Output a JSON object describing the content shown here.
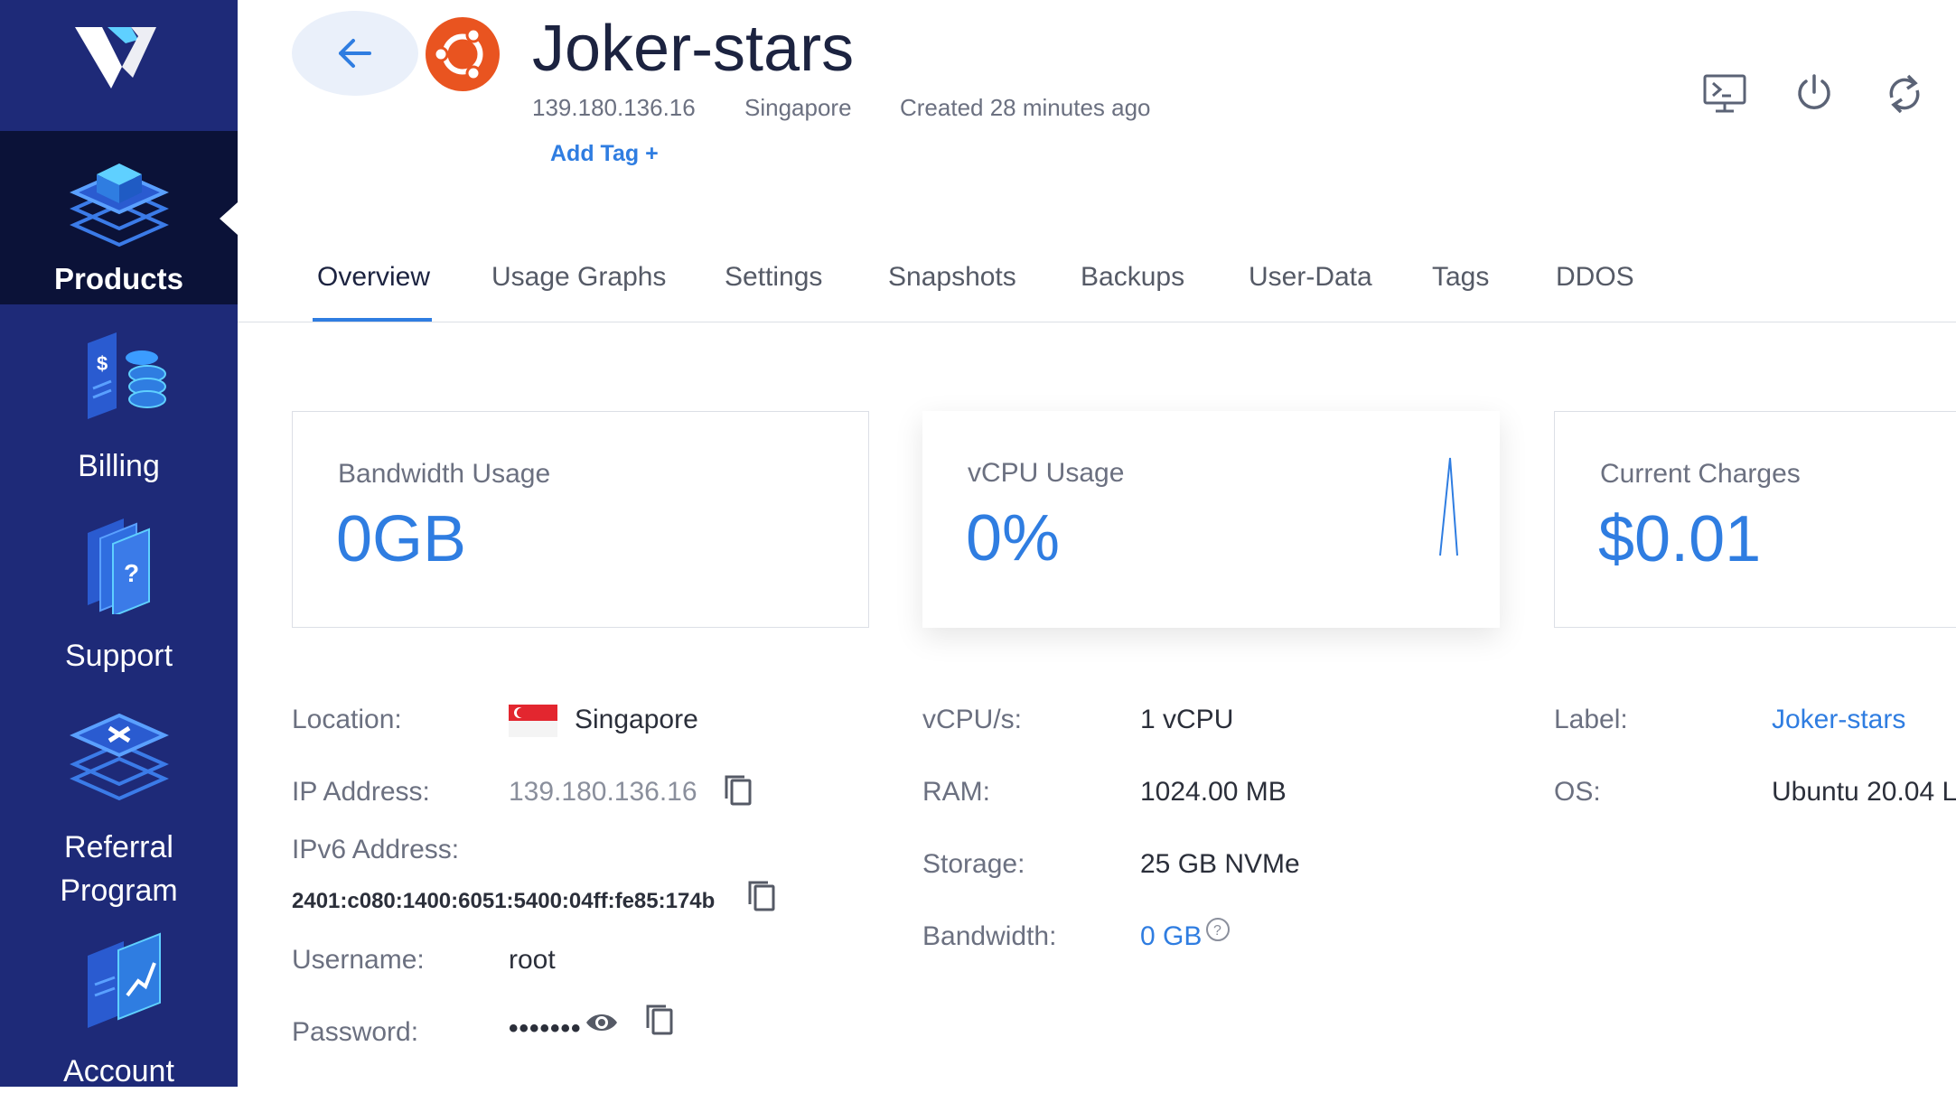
{
  "sidebar": {
    "items": [
      {
        "label": "Products",
        "icon": "products-stack-icon",
        "active": true
      },
      {
        "label": "Billing",
        "icon": "billing-coins-icon"
      },
      {
        "label": "Support",
        "icon": "support-question-icon"
      },
      {
        "label": "Referral Program",
        "label_line1": "Referral",
        "label_line2": "Program",
        "icon": "referral-icon"
      },
      {
        "label": "Account",
        "icon": "account-chart-icon"
      }
    ]
  },
  "header": {
    "title": "Joker-stars",
    "ip": "139.180.136.16",
    "location": "Singapore",
    "created": "Created 28 minutes ago",
    "add_tag": "Add Tag +",
    "os_icon": "ubuntu-logo-icon"
  },
  "tabs": [
    "Overview",
    "Usage Graphs",
    "Settings",
    "Snapshots",
    "Backups",
    "User-Data",
    "Tags",
    "DDOS"
  ],
  "cards": {
    "bandwidth": {
      "title": "Bandwidth Usage",
      "value": "0GB"
    },
    "vcpu": {
      "title": "vCPU Usage",
      "value": "0%"
    },
    "charges": {
      "title": "Current Charges",
      "value": "$0.01"
    }
  },
  "details": {
    "location_label": "Location:",
    "location_value": "Singapore",
    "ip_label": "IP Address:",
    "ip_value": "139.180.136.16",
    "ipv6_label": "IPv6 Address:",
    "ipv6_value": "2401:c080:1400:6051:5400:04ff:fe85:174b",
    "username_label": "Username:",
    "username_value": "root",
    "password_label": "Password:",
    "password_value": "•••••••",
    "vcpus_label": "vCPU/s:",
    "vcpus_value": "1 vCPU",
    "ram_label": "RAM:",
    "ram_value": "1024.00 MB",
    "storage_label": "Storage:",
    "storage_value": "25 GB NVMe",
    "bandwidth_label": "Bandwidth:",
    "bandwidth_value": "0 GB",
    "label_label": "Label:",
    "label_value": "Joker-stars",
    "os_label": "OS:",
    "os_value": "Ubuntu 20.04 L"
  },
  "colors": {
    "sidebar": "#1e2a78",
    "sidebar_active": "#0b1238",
    "accent": "#2f7de1",
    "ubuntu": "#e95420"
  }
}
